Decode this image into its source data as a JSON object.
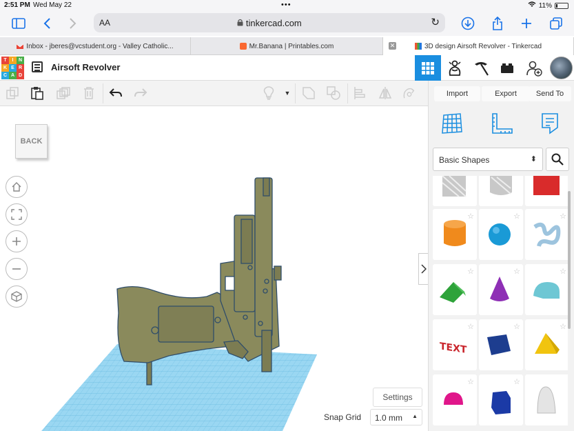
{
  "status": {
    "time": "2:51 PM",
    "date": "Wed May 22",
    "battery": "11%"
  },
  "browser": {
    "aa": "AA",
    "url": "tinkercad.com"
  },
  "tabs": [
    {
      "label": "Inbox - jberes@vcstudent.org - Valley Catholic...",
      "icon": "gmail-icon"
    },
    {
      "label": "Mr.Banana | Printables.com",
      "icon": "printables-icon"
    },
    {
      "label": "3D design Airsoft Revolver - Tinkercad",
      "icon": "tinkercad-icon",
      "active": true
    }
  ],
  "logo": [
    "T",
    "I",
    "N",
    "K",
    "E",
    "R",
    "C",
    "A",
    "D"
  ],
  "project": {
    "title": "Airsoft Revolver"
  },
  "right_panel": {
    "import": "Import",
    "export": "Export",
    "send_to": "Send To",
    "shape_library": "Basic Shapes"
  },
  "viewport": {
    "back": "BACK",
    "settings": "Settings",
    "snap_label": "Snap Grid",
    "snap_value": "1.0 mm"
  },
  "colors": {
    "accent": "#1a8ee0",
    "model": "#8a8a5c",
    "grid": "#7ecff0"
  }
}
